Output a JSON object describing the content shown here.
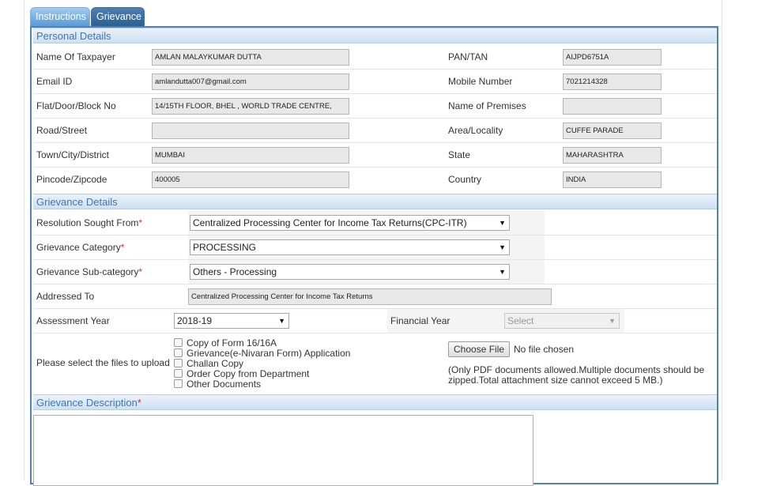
{
  "tabs": {
    "instructions": "Instructions",
    "grievance": "Grievance"
  },
  "personal": {
    "heading": "Personal Details",
    "name_label": "Name Of Taxpayer",
    "name_value": "AMLAN MALAYKUMAR DUTTA",
    "pan_label": "PAN/TAN",
    "pan_value": "AIJPD6751A",
    "email_label": "Email ID",
    "email_value": "amlandutta007@gmail.com",
    "mobile_label": "Mobile Number",
    "mobile_value": "7021214328",
    "flat_label": "Flat/Door/Block No",
    "flat_value": "14/15TH FLOOR, BHEL , WORLD TRADE CENTRE,",
    "premises_label": "Name of Premises",
    "premises_value": "",
    "road_label": "Road/Street",
    "road_value": "",
    "area_label": "Area/Locality",
    "area_value": "CUFFE PARADE",
    "town_label": "Town/City/District",
    "town_value": "MUMBAI",
    "state_label": "State",
    "state_value": "MAHARASHTRA",
    "pin_label": "Pincode/Zipcode",
    "pin_value": "400005",
    "country_label": "Country",
    "country_value": "INDIA"
  },
  "grievance": {
    "heading": "Grievance Details",
    "resolution_label": "Resolution Sought From",
    "resolution_value": "Centralized Processing Center for Income Tax Returns(CPC-ITR)",
    "category_label": "Grievance Category",
    "category_value": "PROCESSING",
    "subcategory_label": "Grievance Sub-category",
    "subcategory_value": "Others - Processing",
    "addressed_label": "Addressed To",
    "addressed_value": "Centralized Processing Center for Income Tax Returns",
    "ay_label": "Assessment Year",
    "ay_value": "2018-19",
    "fy_label": "Financial Year",
    "fy_placeholder": "Select",
    "upload_label": "Please select the files to upload",
    "files": [
      "Copy of Form 16/16A",
      "Grievance(e-Nivaran Form) Application",
      "Challan Copy",
      "Order Copy from Department",
      "Other Documents"
    ],
    "choose_file": "Choose File",
    "no_file": "No file chosen",
    "upload_note": "(Only PDF documents allowed.Multiple documents should be zipped.Total attachment size cannot exceed 5 MB.)",
    "required_mark": "*",
    "dropdown_arrow": "▼"
  },
  "description": {
    "heading": "Grievance Description",
    "value": ""
  }
}
